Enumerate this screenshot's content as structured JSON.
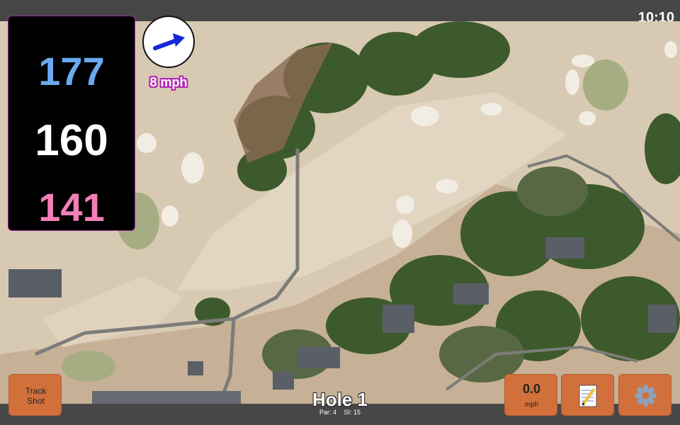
{
  "status": {
    "time": "10:10"
  },
  "distances": {
    "back": "177",
    "center": "160",
    "front": "141"
  },
  "wind": {
    "speed": "8 mph",
    "icon": "wind-arrow-icon"
  },
  "track_button": {
    "label": "Track Shot"
  },
  "speed_button": {
    "value": "0.0",
    "unit": "mph"
  },
  "notes_button": {
    "icon": "notes-icon"
  },
  "settings_button": {
    "icon": "gear-icon"
  },
  "hole": {
    "title": "Hole 1",
    "par": "Par: 4",
    "si": "SI: 15"
  },
  "colors": {
    "back": "#6aaaf0",
    "center": "#ffffff",
    "front": "#f27fb8",
    "button": "#d2703b",
    "accent": "#b42ab4"
  }
}
